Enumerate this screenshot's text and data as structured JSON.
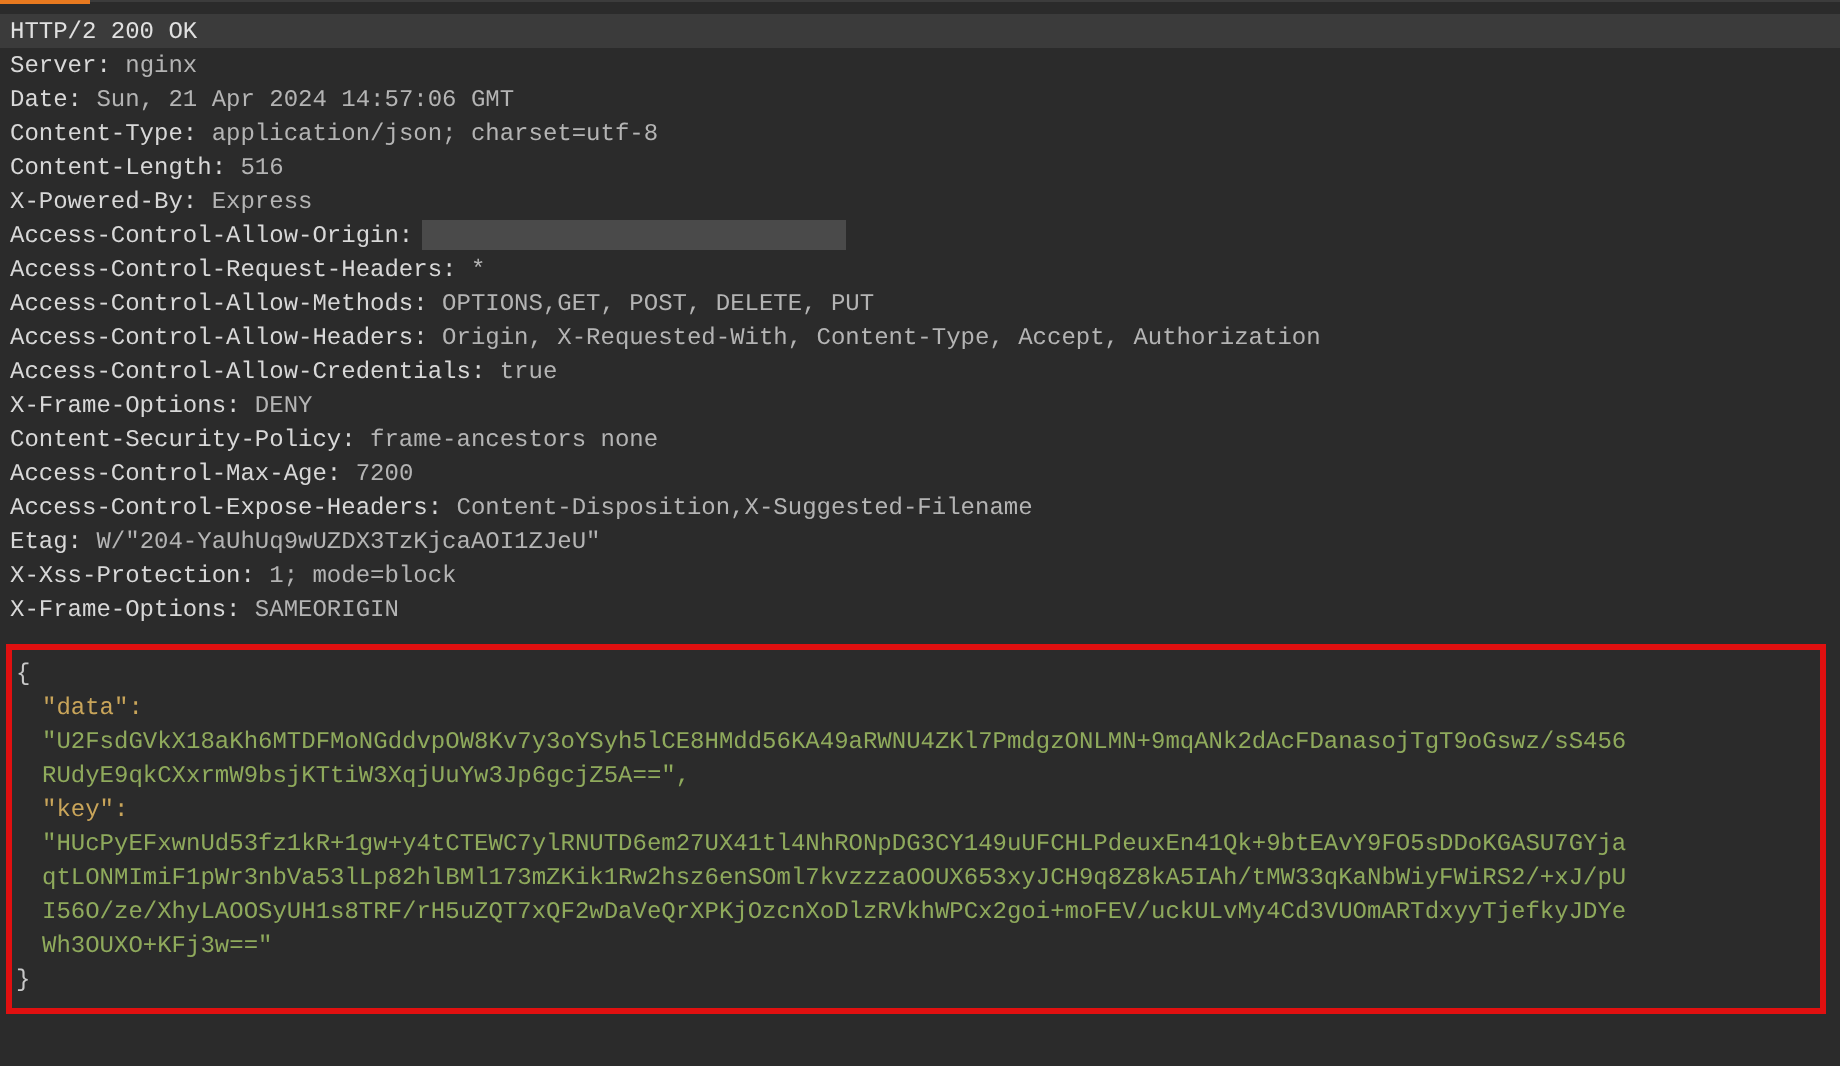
{
  "status_line": {
    "text": "HTTP/2 200 OK",
    "selected": true
  },
  "headers": [
    {
      "name": "Server:",
      "value": "nginx",
      "redacted": false
    },
    {
      "name": "Date:",
      "value": "Sun, 21 Apr 2024 14:57:06 GMT",
      "redacted": false
    },
    {
      "name": "Content-Type:",
      "value": "application/json; charset=utf-8",
      "redacted": false
    },
    {
      "name": "Content-Length:",
      "value": "516",
      "redacted": false
    },
    {
      "name": "X-Powered-By:",
      "value": "Express",
      "redacted": false
    },
    {
      "name": "Access-Control-Allow-Origin:",
      "redacted": true
    },
    {
      "name": "Access-Control-Request-Headers:",
      "value": "*",
      "redacted": false
    },
    {
      "name": "Access-Control-Allow-Methods:",
      "value": "OPTIONS,GET, POST, DELETE, PUT",
      "redacted": false
    },
    {
      "name": "Access-Control-Allow-Headers:",
      "value": "Origin, X-Requested-With, Content-Type, Accept, Authorization",
      "redacted": false
    },
    {
      "name": "Access-Control-Allow-Credentials:",
      "value": "true",
      "redacted": false
    },
    {
      "name": "X-Frame-Options:",
      "value": "DENY",
      "redacted": false
    },
    {
      "name": "Content-Security-Policy:",
      "value": "frame-ancestors none",
      "redacted": false
    },
    {
      "name": "Access-Control-Max-Age:",
      "value": "7200",
      "redacted": false
    },
    {
      "name": "Access-Control-Expose-Headers:",
      "value": "Content-Disposition,X-Suggested-Filename",
      "redacted": false
    },
    {
      "name": "Etag:",
      "value": "W/\"204-YaUhUq9wUZDX3TzKjcaAOI1ZJeU\"",
      "redacted": false
    },
    {
      "name": "X-Xss-Protection:",
      "value": "1; mode=block",
      "redacted": false
    },
    {
      "name": "X-Frame-Options:",
      "value": "SAMEORIGIN",
      "redacted": false
    }
  ],
  "body": {
    "highlighted": true,
    "lines": [
      {
        "kind": "brace",
        "text": "{"
      },
      {
        "kind": "key",
        "text": "\"data\":"
      },
      {
        "kind": "string",
        "text": "\"U2FsdGVkX18aKh6MTDFMoNGddvpOW8Kv7y3oYSyh5lCE8HMdd56KA49aRWNU4ZKl7PmdgzONLMN+9mqANk2dAcFDanasojTgT9oGswz/sS456"
      },
      {
        "kind": "string",
        "text": "RUdyE9qkCXxrmW9bsjKTtiW3XqjUuYw3Jp6gcjZ5A==\","
      },
      {
        "kind": "key",
        "text": "\"key\":"
      },
      {
        "kind": "string",
        "text": "\"HUcPyEFxwnUd53fz1kR+1gw+y4tCTEWC7ylRNUTD6em27UX41tl4NhRONpDG3CY149uUFCHLPdeuxEn41Qk+9btEAvY9FO5sDDoKGASU7GYja"
      },
      {
        "kind": "string",
        "text": "qtLONMImiF1pWr3nbVa53lLp82hlBMl173mZKik1Rw2hsz6enSOml7kvzzzaOOUX653xyJCH9q8Z8kA5IAh/tMW33qKaNbWiyFWiRS2/+xJ/pU"
      },
      {
        "kind": "string",
        "text": "I56O/ze/XhyLAOOSyUH1s8TRF/rH5uZQT7xQF2wDaVeQrXPKjOzcnXoDlzRVkhWPCx2goi+moFEV/uckULvMy4Cd3VUOmARTdxyyTjefkyJDYe"
      },
      {
        "kind": "string",
        "text": "Wh3OUXO+KFj3w==\""
      },
      {
        "kind": "brace",
        "text": "}"
      }
    ]
  }
}
